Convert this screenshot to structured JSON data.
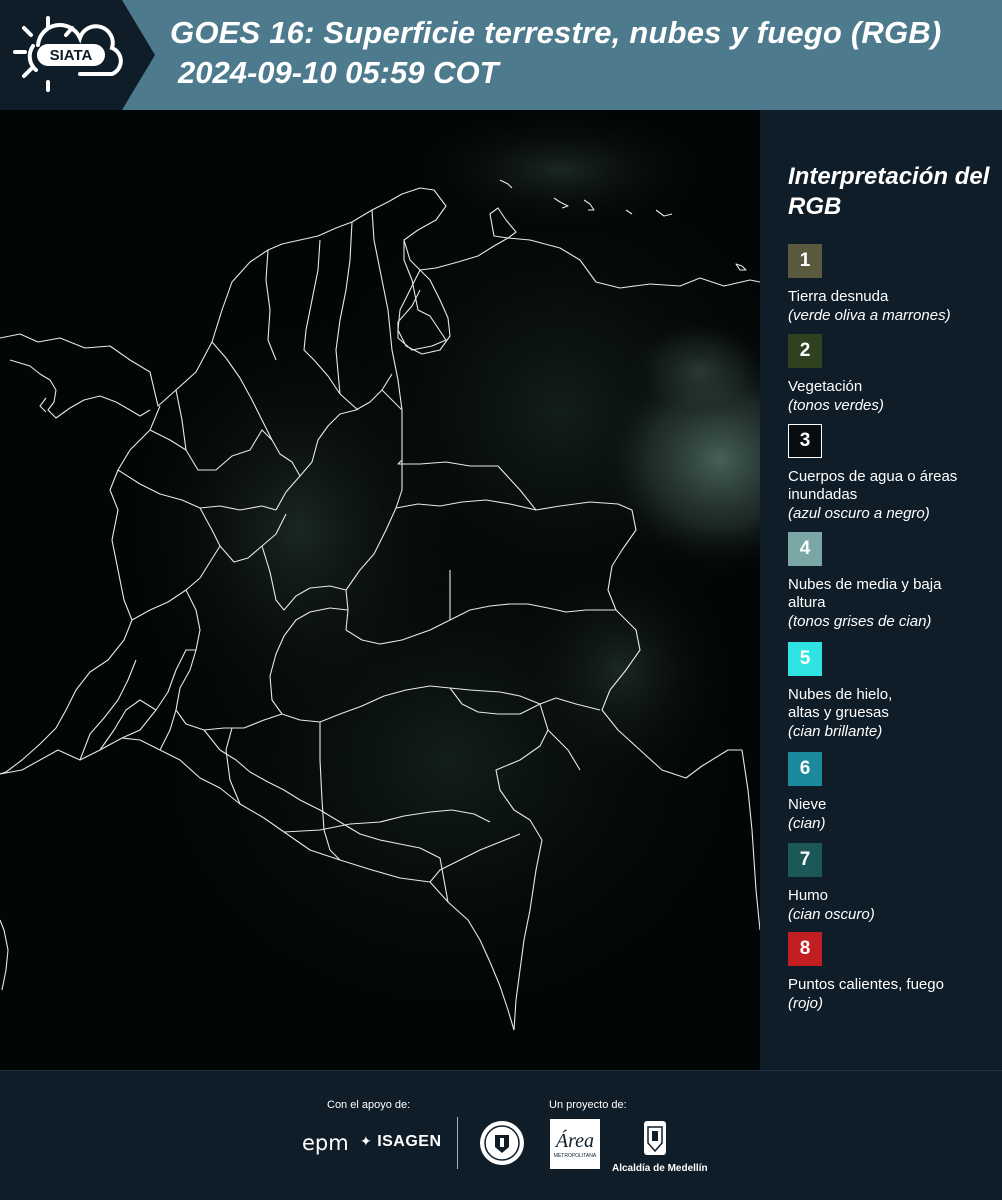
{
  "header": {
    "logo_text": "SIATA",
    "title": "GOES 16: Superficie terrestre, nubes y fuego (RGB)",
    "datetime": "2024-09-10 05:59 COT"
  },
  "legend": {
    "title": "Interpretación del RGB",
    "items": [
      {
        "num": "1",
        "label": "Tierra desnuda",
        "sub": "(verde oliva a marrones)",
        "color": "#5a5b3e"
      },
      {
        "num": "2",
        "label": "Vegetación",
        "sub": "(tonos verdes)",
        "color": "#2f4220"
      },
      {
        "num": "3",
        "label": "Cuerpos de agua o áreas inundadas",
        "sub": "(azul oscuro a negro)",
        "color": "#0a0d10"
      },
      {
        "num": "4",
        "label": "Nubes de media y baja altura",
        "sub": "(tonos grises de cian)",
        "color": "#7aa6a6"
      },
      {
        "num": "5",
        "label": "Nubes de hielo, altas y gruesas",
        "sub": "(cian brillante)",
        "color": "#2fe3e3"
      },
      {
        "num": "6",
        "label": "Nieve",
        "sub": "(cian)",
        "color": "#1a8a9c"
      },
      {
        "num": "7",
        "label": "Humo",
        "sub": "(cian oscuro)",
        "color": "#1d5858"
      },
      {
        "num": "8",
        "label": "Puntos calientes, fuego",
        "sub": "(rojo)",
        "color": "#c21f23"
      }
    ]
  },
  "footer": {
    "support_label": "Con el apoyo de:",
    "project_label": "Un proyecto de:",
    "epm": "epm",
    "isagen": "ISAGEN",
    "area_caption": "METROPOLITANA",
    "alcaldia": "Alcaldía de Medellín"
  },
  "icons": {
    "logo": "sun-cloud-icon",
    "seal": "municipal-seal-icon",
    "area": "area-metropolitana-logo",
    "alcaldia": "coat-of-arms-icon"
  }
}
